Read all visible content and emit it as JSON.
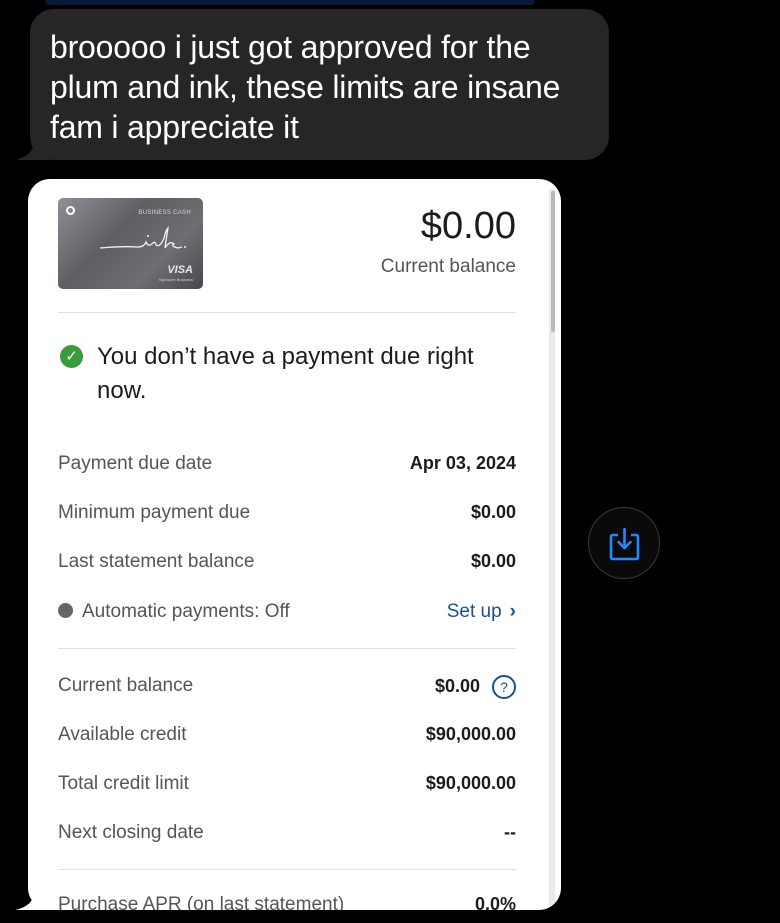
{
  "message": {
    "text": "brooooo i just got approved for the plum and ink, these limits are insane fam i appreciate it"
  },
  "card": {
    "type_label": "BUSINESS CASH",
    "network": "VISA",
    "sub": "Signature Business"
  },
  "balance": {
    "amount": "$0.00",
    "label": "Current balance"
  },
  "notice": {
    "text": "You don’t have a payment due right now."
  },
  "payment_rows": [
    {
      "label": "Payment due date",
      "value": "Apr 03, 2024"
    },
    {
      "label": "Minimum payment due",
      "value": "$0.00"
    },
    {
      "label": "Last statement balance",
      "value": "$0.00"
    }
  ],
  "autopay": {
    "label": "Automatic payments: Off",
    "action": "Set up"
  },
  "account_rows": [
    {
      "label": "Current balance",
      "value": "$0.00"
    },
    {
      "label": "Available credit",
      "value": "$90,000.00"
    },
    {
      "label": "Total credit limit",
      "value": "$90,000.00"
    },
    {
      "label": "Next closing date",
      "value": "--"
    },
    {
      "label": "Purchase APR (on last statement)",
      "value": "0.0%"
    }
  ],
  "icons": {
    "check": "check-circle-icon",
    "help": "question-circle-icon",
    "chevron": "chevron-right-icon",
    "save": "save-download-icon"
  },
  "colors": {
    "accent": "#1a4f8f",
    "success": "#3b9a3a",
    "bubble": "#262629",
    "save_icon": "#1f8bff"
  }
}
